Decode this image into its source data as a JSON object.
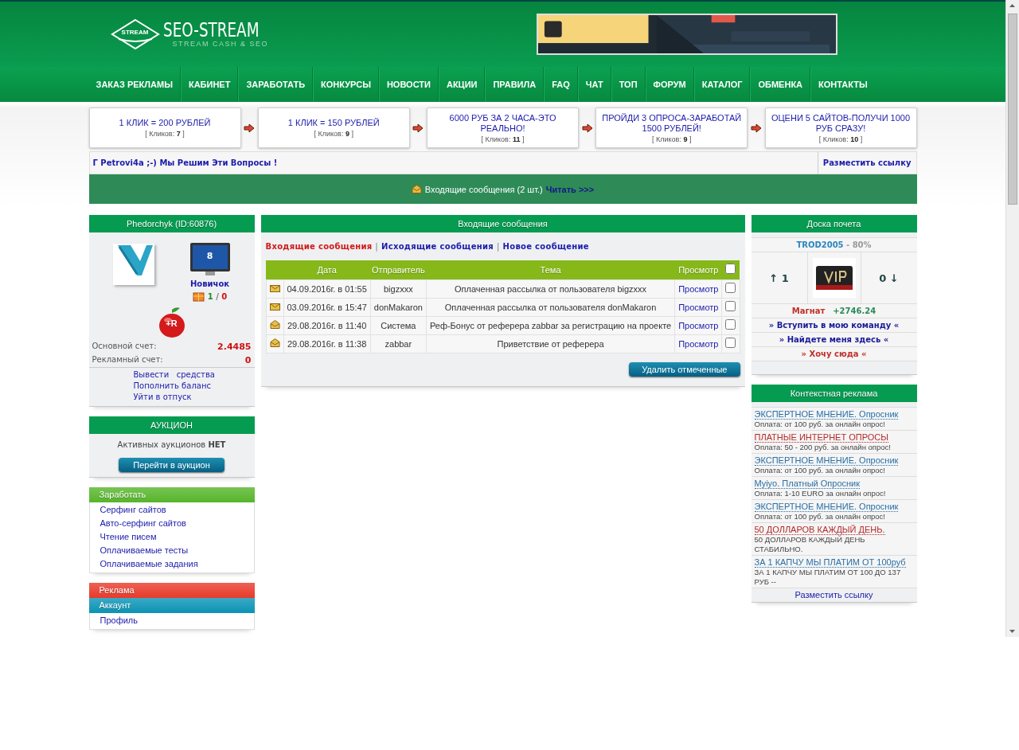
{
  "logo": {
    "emblem": "STREAM",
    "title": "SEO-STREAM",
    "subtitle": "STREAM CASH & SEO"
  },
  "nav": [
    "ЗАКАЗ РЕКЛАМЫ",
    "КАБИНЕТ",
    "ЗАРАБОТАТЬ",
    "КОНКУРСЫ",
    "НОВОСТИ",
    "АКЦИИ",
    "ПРАВИЛА",
    "FAQ",
    "ЧАТ",
    "ТОП",
    "ФОРУМ",
    "КАТАЛОГ",
    "ОБМЕНКА",
    "КОНТАКТЫ"
  ],
  "promos": [
    {
      "title": "1 КЛИК = 200 РУБЛЕЙ",
      "clicks": "[ Кликов: **7** ]"
    },
    {
      "title": "1 КЛИК = 150 РУБЛЕЙ",
      "clicks": "[ Кликов: **9** ]"
    },
    {
      "title": "6000 РУБ ЗА 2 ЧАСА-ЭТО РЕАЛЬНО!",
      "clicks": "[ Кликов: **11** ]"
    },
    {
      "title": "ПРОЙДИ 3 ОПРОСА-ЗАРАБОТАЙ 1500 РУБЛЕЙ!",
      "clicks": "[ Кликов: **9** ]"
    },
    {
      "title": "ОЦЕНИ 5 САЙТОВ-ПОЛУЧИ 1000 РУБ СРАЗУ!",
      "clicks": "[ Кликов: **10** ]"
    }
  ],
  "ticker": {
    "text": "Г Petrovi4a ;-) Мы Решим Эти Вопросы !",
    "link": "Разместить ссылку"
  },
  "notice": {
    "text": "Входящие сообщения (2 шт.)",
    "link": "Читать >>>"
  },
  "user_panel": {
    "title": "Phedorchyk (ID:60876)",
    "level": "8",
    "rank": "Новичок",
    "votes": {
      "up": "1",
      "separator": "/",
      "down": "0"
    },
    "badge": "+R",
    "accounts": [
      {
        "label": "Основной счет:",
        "value": "2.4485"
      },
      {
        "label": "Рекламный счет:",
        "value": "0"
      }
    ],
    "links": [
      "Вывести   средства",
      "Пополнить баланс",
      "Уйти в отпуск"
    ]
  },
  "auction": {
    "title": "АУКЦИОН",
    "text": "Активных аукционов **НЕТ**",
    "button": "Перейти в аукцион"
  },
  "menu_panels": [
    {
      "sections": [
        {
          "title": "Заработать",
          "color": "#56b52a",
          "items": [
            "Серфинг сайтов",
            "Авто-серфинг сайтов",
            "Чтение писем",
            "Оплачиваемые тесты",
            "Оплачиваемые задания"
          ]
        }
      ]
    },
    {
      "sections": [
        {
          "title": "Реклама",
          "color": "#e83a2a"
        },
        {
          "title": "Аккаунт",
          "color": "#0a93b5",
          "items": [
            "Профиль"
          ]
        }
      ]
    }
  ],
  "messages": {
    "title": "Входящие сообщения",
    "tabs": [
      {
        "label": "Входящие сообщения",
        "selected": true
      },
      {
        "label": "Исходящие сообщения",
        "selected": false
      },
      {
        "label": "Новое сообщение",
        "selected": false
      }
    ],
    "separator": "|",
    "columns": [
      "Дата",
      "Отправитель",
      "Тема",
      "Просмотр"
    ],
    "select_all": {
      "checked": false
    },
    "rows": [
      {
        "read": false,
        "date": "04.09.2016г. в 01:55",
        "sender": "bigzxxx",
        "subject": "Оплаченная рассылка от пользователя bigzxxx",
        "view": "Просмотр",
        "checked": false
      },
      {
        "read": false,
        "date": "03.09.2016г. в 15:47",
        "sender": "donMakaron",
        "subject": "Оплаченная рассылка от пользователя donMakaron",
        "view": "Просмотр",
        "checked": false
      },
      {
        "read": true,
        "date": "29.08.2016г. в 11:40",
        "sender": "Система",
        "subject": "Реф-Бонус от реферера zabbar за регистрацию на проекте",
        "view": "Просмотр",
        "checked": false
      },
      {
        "read": true,
        "date": "29.08.2016г. в 11:38",
        "sender": "zabbar",
        "subject": "Приветствие от реферера",
        "view": "Просмотр",
        "checked": false
      }
    ],
    "delete_button": "Удалить отмеченные"
  },
  "honor": {
    "title": "Доска почета",
    "name": "TROD2005",
    "percent": "- 80%",
    "up": "↑ 1",
    "down": "0 ↓",
    "rank": "Магнат",
    "amount": "+2746.24",
    "links": [
      {
        "text": "» Вступить в мою команду «",
        "color": "#1a1a99"
      },
      {
        "text": "» Найдете меня здесь «",
        "color": "#1a1a99"
      },
      {
        "text": "» Хочу сюда «",
        "color": "#c0302a"
      }
    ]
  },
  "context_ads": {
    "title": "Контекстная реклама",
    "ads": [
      {
        "title": "ЭКСПЕРТНОЕ МНЕНИЕ. Опросник",
        "text": "Оплата: от 100 руб. за онлайн опрос!",
        "color": "#2a6fa5"
      },
      {
        "title": "ПЛАТНЫЕ ИНТЕРНЕТ ОПРОСЫ",
        "text": "Оплата: 50 - 200 руб. за онлайн опрос!",
        "color": "#b52a2a"
      },
      {
        "title": "ЭКСПЕРТНОЕ МНЕНИЕ. Опросник",
        "text": "Оплата: от 100 руб. за онлайн опрос!",
        "color": "#2a6fa5"
      },
      {
        "title": "Myiyo. Платный Опросник",
        "text": "Оплата: 1-10 EURO за онлайн опрос!",
        "color": "#2a6fa5"
      },
      {
        "title": "ЭКСПЕРТНОЕ МНЕНИЕ. Опросник",
        "text": "Оплата: от 100 руб. за онлайн опрос!",
        "color": "#2a6fa5"
      },
      {
        "title": "50 ДОЛЛАРОВ КАЖДЫЙ ДЕНЬ.",
        "text": "50 ДОЛЛАРОВ КАЖДЫЙ ДЕНЬ СТАБИЛЬНО.",
        "color": "#b52a2a"
      },
      {
        "title": "ЗА 1 КАПЧУ МЫ ПЛАТИМ ОТ 100руб",
        "text": "ЗА 1 КАПЧУ МЫ ПЛАТИМ ОТ 100 ДО 137 РУБ --",
        "color": "#2a6fa5"
      }
    ],
    "link": "Разместить ссылку"
  }
}
